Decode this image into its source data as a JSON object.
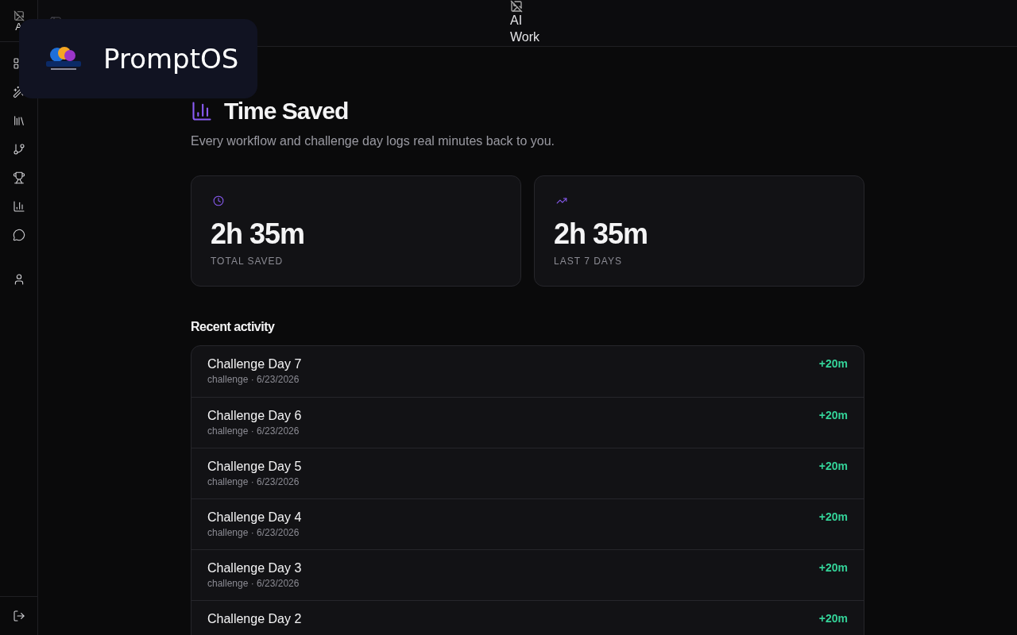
{
  "sidebar": {
    "logo_alt": "A"
  },
  "header": {
    "logo_alt": "AI Work"
  },
  "overlay": {
    "title": "PromptOS"
  },
  "page": {
    "title": "Time Saved",
    "subtitle": "Every workflow and challenge day logs real minutes back to you."
  },
  "stats": [
    {
      "value": "2h 35m",
      "label": "TOTAL SAVED"
    },
    {
      "value": "2h 35m",
      "label": "LAST 7 DAYS"
    }
  ],
  "activity": {
    "title": "Recent activity",
    "rows": [
      {
        "title": "Challenge Day 7",
        "meta": "challenge · 6/23/2026",
        "amount": "+20m"
      },
      {
        "title": "Challenge Day 6",
        "meta": "challenge · 6/23/2026",
        "amount": "+20m"
      },
      {
        "title": "Challenge Day 5",
        "meta": "challenge · 6/23/2026",
        "amount": "+20m"
      },
      {
        "title": "Challenge Day 4",
        "meta": "challenge · 6/23/2026",
        "amount": "+20m"
      },
      {
        "title": "Challenge Day 3",
        "meta": "challenge · 6/23/2026",
        "amount": "+20m"
      },
      {
        "title": "Challenge Day 2",
        "meta": "",
        "amount": "+20m"
      }
    ]
  }
}
